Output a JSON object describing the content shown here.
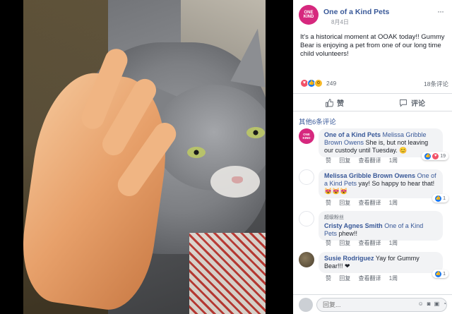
{
  "post": {
    "page_logo_text": "ONE KIND",
    "page_name": "One of a Kind Pets",
    "date": "8月4日",
    "text": "It's a historical moment at OOAK today!! Gummy Bear is enjoying a pet from one of our long time child volunteers!",
    "reaction_count": "249",
    "comment_count": "18条评论",
    "like_label": "赞",
    "comment_label": "评论"
  },
  "more_comments_label": "其他6条评论",
  "comments": [
    {
      "author": "One of a Kind Pets",
      "mention": "Melissa Gribble Brown Owens",
      "text": " She is, but not leaving our custody until Tuesday. 😊",
      "like": "赞",
      "reply": "回复",
      "translate": "查看翻译",
      "time": "1周",
      "reactions": "19"
    },
    {
      "author": "Melissa Gribble Brown Owens",
      "mention": "One of a Kind Pets",
      "text": " yay! So happy to hear that! 😻😻😻",
      "like": "赞",
      "reply": "回复",
      "translate": "查看翻译",
      "time": "1周",
      "reactions": "1"
    },
    {
      "badge": "超级粉丝",
      "author": "Cristy Agnes Smith",
      "mention": "One of a Kind Pets",
      "text": " phew!!",
      "like": "赞",
      "reply": "回复",
      "translate": "查看翻译",
      "time": "1周"
    },
    {
      "author": "Susie Rodriguez",
      "text": " Yay for Gummy Bear!!! ❤",
      "like": "赞",
      "reply": "回复",
      "translate": "查看翻译",
      "time": "1周",
      "reactions": "1"
    }
  ],
  "write_placeholder": "回复..."
}
